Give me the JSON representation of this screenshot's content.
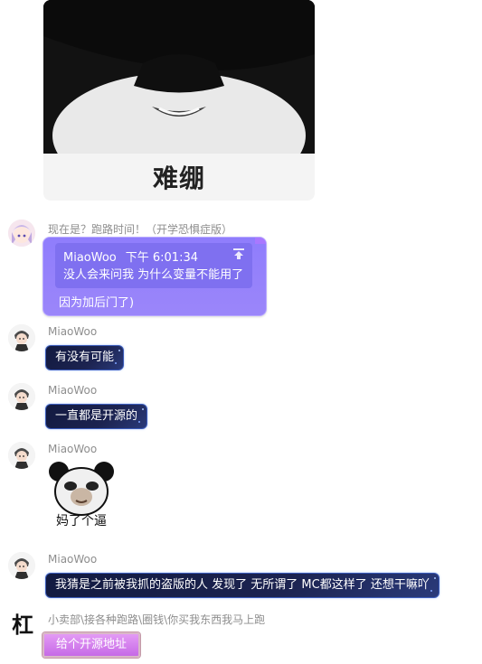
{
  "sticker_top": {
    "caption": "难绷"
  },
  "messages": [
    {
      "sender": "现在是？跑路时间！（开学恐惧症版）",
      "quote": {
        "author": "MiaoWoo",
        "time": "下午 6:01:34",
        "text": "没人会来问我 为什么变量不能用了"
      },
      "text": "因为加后门了)"
    },
    {
      "sender": "MiaoWoo",
      "text": "有没有可能"
    },
    {
      "sender": "MiaoWoo",
      "text": "一直都是开源的"
    },
    {
      "sender": "MiaoWoo",
      "sticker_caption": "妈了个逼"
    },
    {
      "sender": "MiaoWoo",
      "text": "我猜是之前被我抓的盗版的人 发现了 无所谓了 MC都这样了 还想干嘛吖"
    },
    {
      "avatar_glyph": "杠",
      "sender": "小卖部\\接各种跑路\\圈钱\\你买我东西我马上跑",
      "text": "给个开源地址"
    }
  ],
  "colors": {
    "purple_bubble": "#8f7dfc",
    "dark_bubble": "#121a40",
    "pink_bubble": "#d47ff0",
    "sender_gray": "#8e8e8e"
  },
  "icons": [
    "avatar-anime-girl",
    "avatar-chibi-boy",
    "upload-arrow-icon",
    "panda-meme-sticker"
  ]
}
